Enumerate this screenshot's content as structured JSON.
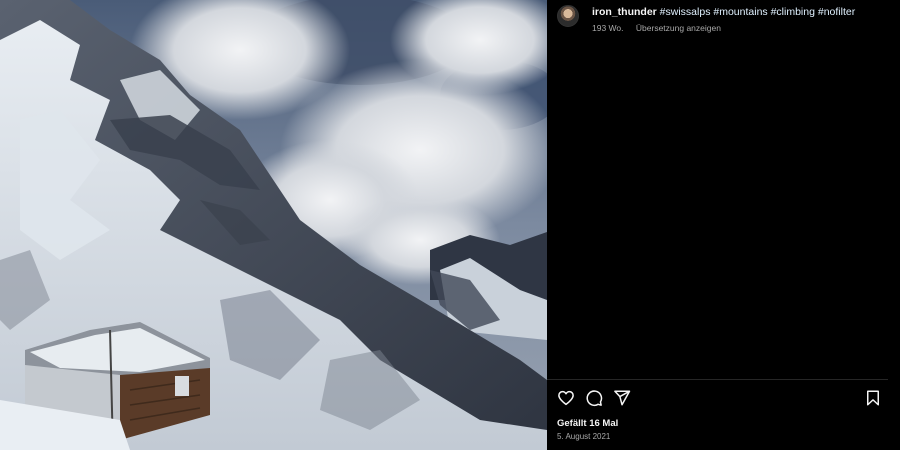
{
  "post": {
    "username": "iron_thunder",
    "hashtags": [
      "#swissalps",
      "#mountains",
      "#climbing",
      "#nofilter"
    ],
    "age": "193 Wo.",
    "translate_label": "Übersetzung anzeigen",
    "likes": "Gefällt 16 Mal",
    "date": "5. August 2021"
  },
  "actions": {
    "like": "heart-icon",
    "comment": "comment-icon",
    "share": "share-icon",
    "save": "bookmark-icon"
  },
  "colors": {
    "background": "#000000",
    "text": "#f5f5f5",
    "muted": "#a8a8a8",
    "hashtag": "#e0f1ff",
    "divider": "#262626"
  }
}
